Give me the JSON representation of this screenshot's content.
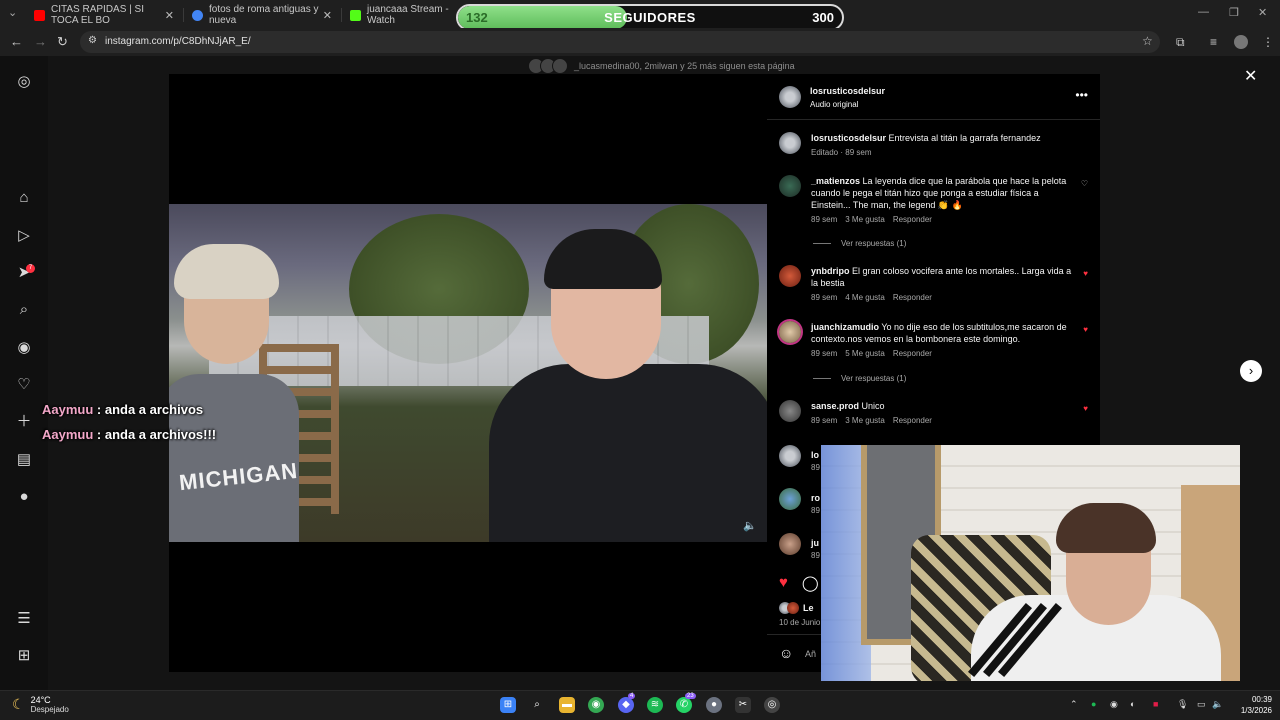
{
  "browser": {
    "tabs": [
      {
        "label": "CITAS RAPIDAS | SI TOCA EL BO",
        "color": "#ff0000"
      },
      {
        "label": "fotos de roma antiguas y nueva",
        "color": "#4285f4"
      },
      {
        "label": "juancaaa Stream - Watch",
        "color": "#53fc18"
      }
    ],
    "url": "instagram.com/p/C8DhNJjAR_E/",
    "window_controls": [
      "—",
      "❐",
      "✕"
    ]
  },
  "followers_goal": {
    "current": "132",
    "label": "SEGUIDORES",
    "goal": "300",
    "progress": 0.44
  },
  "watching": {
    "users": "_lucasmedina00, 2milwan",
    "text": "y 25 más siguen esta página"
  },
  "post": {
    "author": "losrusticosdelsur",
    "audio": "Audio original",
    "caption_user": "losrusticosdelsur",
    "caption": "Entrevista al titán la garrafa fernandez",
    "caption_meta": "Editado · 89 sem",
    "video_text": "MICHIGAN"
  },
  "comments": [
    {
      "user": "_matienzos",
      "text": "La leyenda dice que la parábola que hace la pelota cuando le pega el titán hizo que ponga a estudiar física a Einstein... The man, the legend 👏 🔥",
      "time": "89 sem",
      "likes": "3 Me gusta",
      "reply": "Responder",
      "liked": false
    },
    {
      "user": "ynbdripo",
      "text": "El gran coloso vocifera ante los mortales.. Larga vida a la bestia",
      "time": "89 sem",
      "likes": "4 Me gusta",
      "reply": "Responder",
      "liked": true
    },
    {
      "user": "juanchizamudio",
      "text": "Yo no dije eso de los subtitulos,me sacaron de contexto.nos vemos en la bombonera este domingo.",
      "time": "89 sem",
      "likes": "5 Me gusta",
      "reply": "Responder",
      "liked": true
    },
    {
      "user": "sanse.prod",
      "text": "Unico",
      "time": "89 sem",
      "likes": "3 Me gusta",
      "reply": "Responder",
      "liked": true
    }
  ],
  "more_replies": [
    "Ver respuestas (1)",
    "Ver respuestas (1)"
  ],
  "partial_rows": [
    {
      "user": "lo",
      "time": "89"
    },
    {
      "user": "ro",
      "time": "89"
    },
    {
      "user": "ju",
      "time": "89"
    }
  ],
  "footer": {
    "liked_by": "Le",
    "date": "10 de Junio",
    "add_comment": "Añ"
  },
  "stream_chat": [
    {
      "user": "Aaymuu",
      "message": " : anda a archivos"
    },
    {
      "user": "Aaymuu",
      "message": " : anda a archivos!!!"
    }
  ],
  "taskbar": {
    "temperature": "24°C",
    "condition": "Despejado",
    "time": "00:39",
    "date": "1/3/2026",
    "badges": {
      "discord": "4",
      "whatsapp": "23"
    },
    "sidebar_badge": "7"
  }
}
